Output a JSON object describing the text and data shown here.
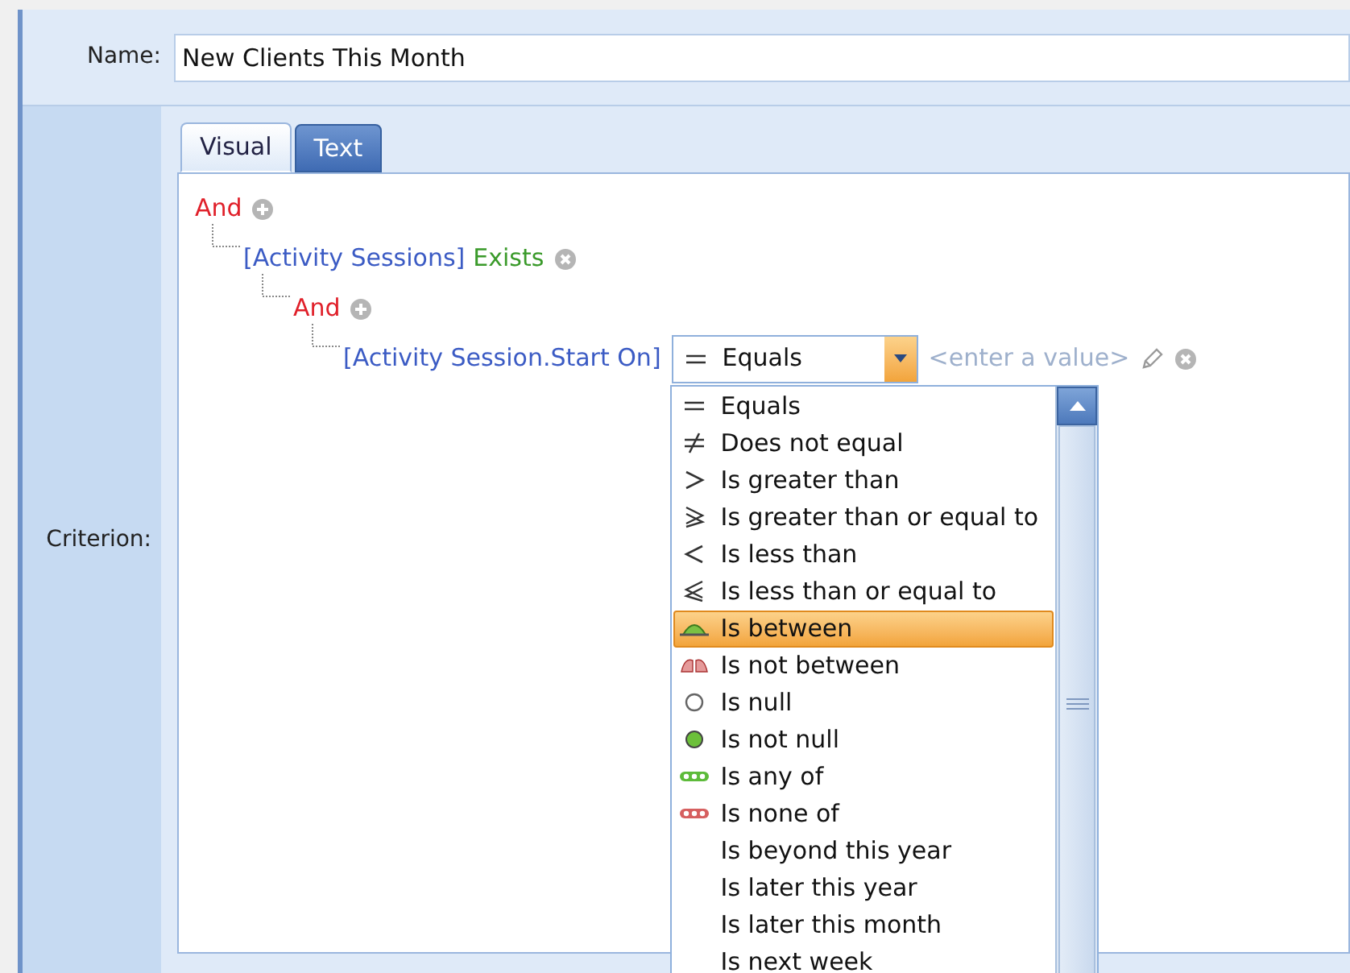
{
  "name_field": {
    "label": "Name:",
    "value": "New Clients This Month"
  },
  "criterion": {
    "label": "Criterion:",
    "tabs": [
      {
        "label": "Visual",
        "selected": true
      },
      {
        "label": "Text",
        "selected": false
      }
    ],
    "tree": [
      {
        "kind": "group",
        "operator": "And",
        "children": [
          {
            "kind": "exists",
            "field": "[Activity Sessions]",
            "operator": "Exists",
            "children": [
              {
                "kind": "group",
                "operator": "And",
                "children": [
                  {
                    "kind": "condition",
                    "field": "[Activity Session.Start On]",
                    "operator": {
                      "kind": "equals",
                      "label": "Equals"
                    },
                    "expanded": true,
                    "placeholder": "<enter a value>",
                    "options": [
                      {
                        "kind": "equals",
                        "label": "Equals",
                        "selected": false
                      },
                      {
                        "kind": "not-equal",
                        "label": "Does not equal",
                        "selected": false
                      },
                      {
                        "kind": "greater",
                        "label": "Is greater than",
                        "selected": false
                      },
                      {
                        "kind": "greater-equal",
                        "label": "Is greater than or equal to",
                        "selected": false
                      },
                      {
                        "kind": "less",
                        "label": "Is less than",
                        "selected": false
                      },
                      {
                        "kind": "less-equal",
                        "label": "Is less than or equal to",
                        "selected": false
                      },
                      {
                        "kind": "between",
                        "label": "Is between",
                        "selected": true
                      },
                      {
                        "kind": "not-between",
                        "label": "Is not between",
                        "selected": false
                      },
                      {
                        "kind": "null",
                        "label": "Is null",
                        "selected": false
                      },
                      {
                        "kind": "not-null",
                        "label": "Is not null",
                        "selected": false
                      },
                      {
                        "kind": "any-of",
                        "label": "Is any of",
                        "selected": false
                      },
                      {
                        "kind": "none-of",
                        "label": "Is none of",
                        "selected": false
                      },
                      {
                        "kind": "plain",
                        "label": "Is beyond this year",
                        "selected": false
                      },
                      {
                        "kind": "plain",
                        "label": "Is later this year",
                        "selected": false
                      },
                      {
                        "kind": "plain",
                        "label": "Is later this month",
                        "selected": false
                      },
                      {
                        "kind": "plain",
                        "label": "Is next week",
                        "selected": false
                      }
                    ]
                  }
                ]
              }
            ]
          }
        ]
      }
    ]
  }
}
